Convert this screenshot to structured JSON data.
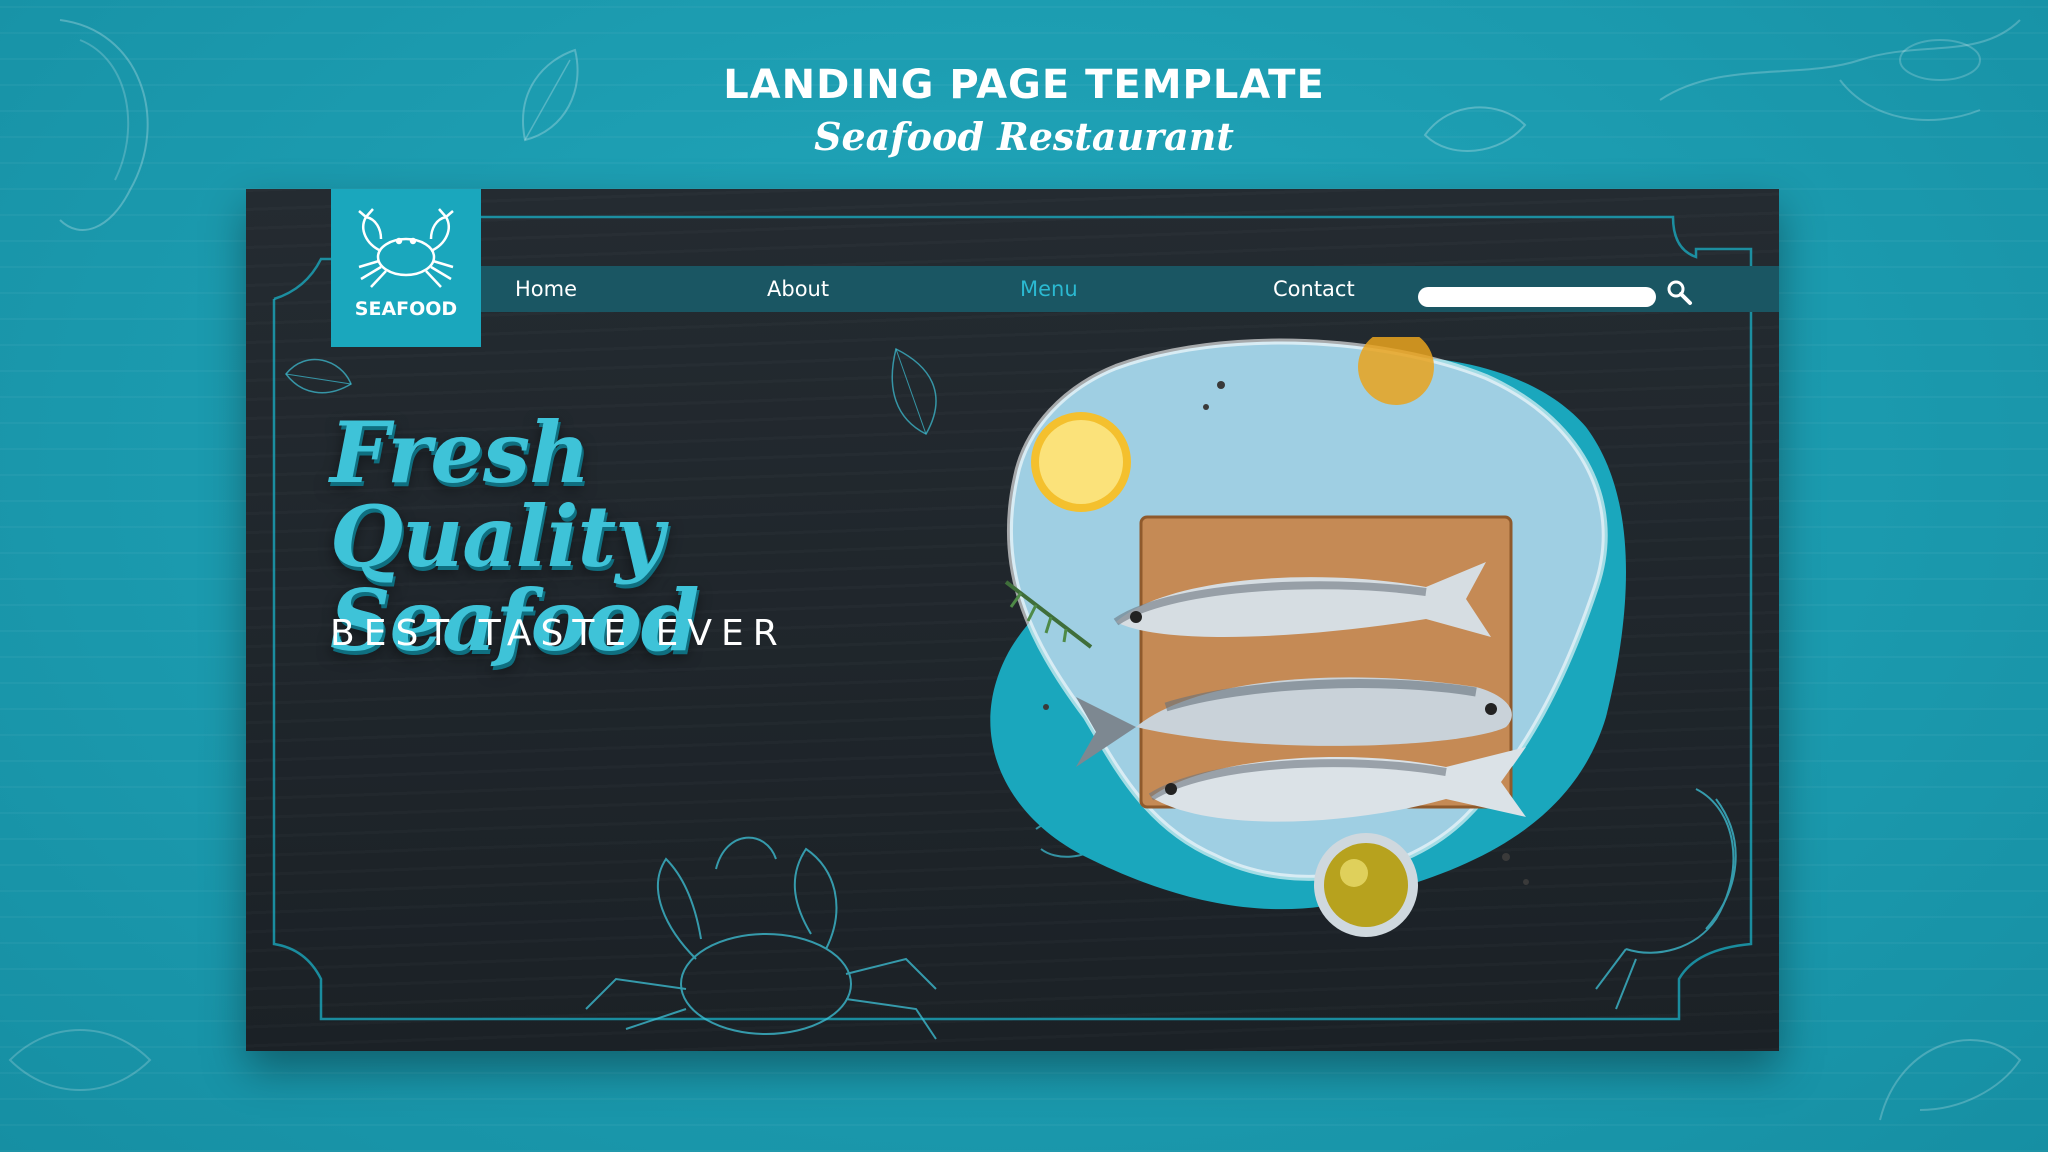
{
  "header": {
    "title": "LANDING PAGE TEMPLATE",
    "subtitle": "Seafood Restaurant"
  },
  "logo": {
    "text": "SEAFOOD",
    "icon": "crab-icon"
  },
  "nav": {
    "items": [
      {
        "label": "Home",
        "active": false
      },
      {
        "label": "About",
        "active": false
      },
      {
        "label": "Menu",
        "active": true
      },
      {
        "label": "Contact",
        "active": false
      }
    ],
    "search": {
      "placeholder": "",
      "icon": "search-icon"
    }
  },
  "hero": {
    "headline": "Fresh Quality Seafood",
    "tagline": "BEST TASTE EVER",
    "image": "fish-on-cutting-board-photo"
  },
  "colors": {
    "background": "#1a9fb3",
    "board": "#1f262b",
    "accent": "#1aa7bd",
    "nav_bar": "#1a5663",
    "active_nav": "#2bb9d1",
    "headline": "#3ec3d8"
  }
}
